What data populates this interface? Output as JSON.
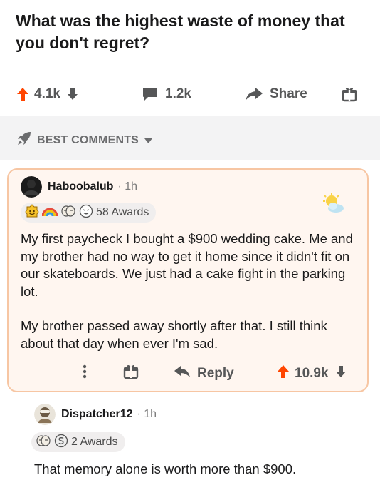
{
  "post": {
    "title": "What was the highest waste of money that you don't regret?",
    "upvotes": "4.1k",
    "comments": "1.2k",
    "share_label": "Share"
  },
  "sort": {
    "label": "BEST COMMENTS"
  },
  "comments": [
    {
      "author": "Haboobalub",
      "time": "1h",
      "awards": "58 Awards",
      "body": [
        "My first paycheck I bought a $900 wedding cake. Me and my brother had no way to get it home since it didn't fit on our skateboards. We just had a cake fight in the parking lot.",
        "My brother passed away shortly after that. I still think about that day when ever I'm sad."
      ],
      "reply_label": "Reply",
      "votes": "10.9k"
    },
    {
      "author": "Dispatcher12",
      "time": "1h",
      "awards": "2 Awards",
      "body": [
        "That memory alone is worth more than $900."
      ]
    }
  ],
  "colors": {
    "upvote": "#ff4500",
    "card_border": "#f7c6a3",
    "card_bg": "#fff6f0",
    "muted": "#565758"
  }
}
